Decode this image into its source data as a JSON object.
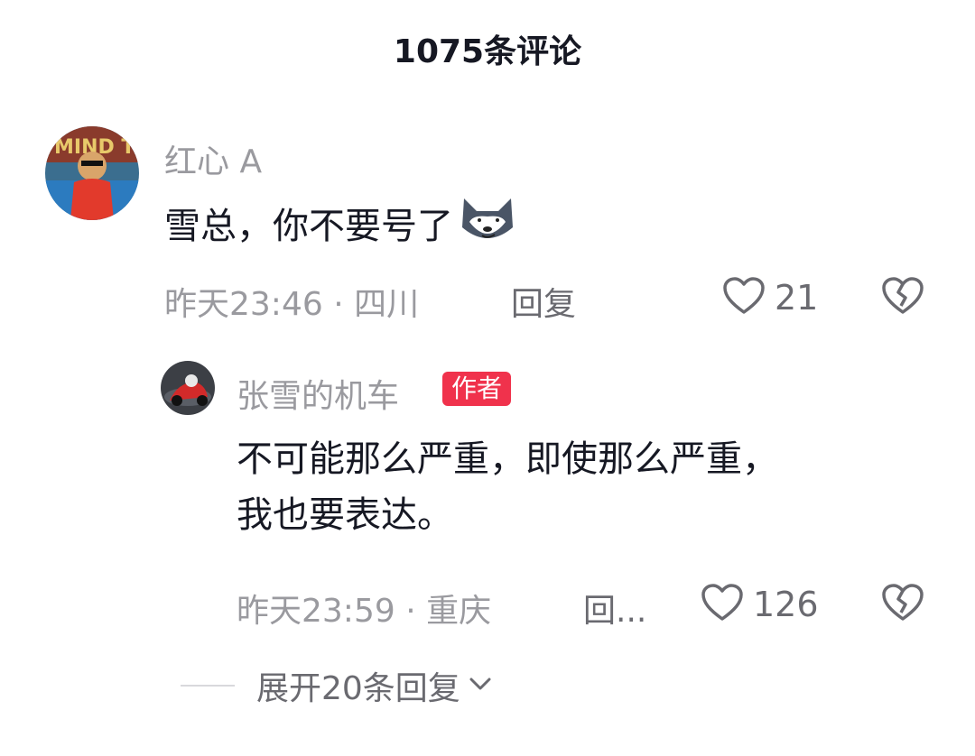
{
  "header": {
    "title": "1075条评论"
  },
  "comment": {
    "avatar": "avatar-dog-red-shirt",
    "username": "红心 A",
    "text": "雪总，你不要号了",
    "emoji": "husky-smirk-emoji",
    "time_location": "昨天23:46 · 四川",
    "reply_label": "回复",
    "likes": "21"
  },
  "reply": {
    "avatar": "avatar-motorcycle-rider",
    "username": "张雪的机车",
    "badge": "作者",
    "text_line1": "不可能那么严重，即使那么严重，",
    "text_line2": "我也要表达。",
    "time_location": "昨天23:59 · 重庆",
    "reply_label": "回...",
    "likes": "126"
  },
  "expand": {
    "label": "展开20条回复"
  },
  "colors": {
    "badge": "#f0324c",
    "muted": "#9a9a9f",
    "text": "#161823"
  }
}
